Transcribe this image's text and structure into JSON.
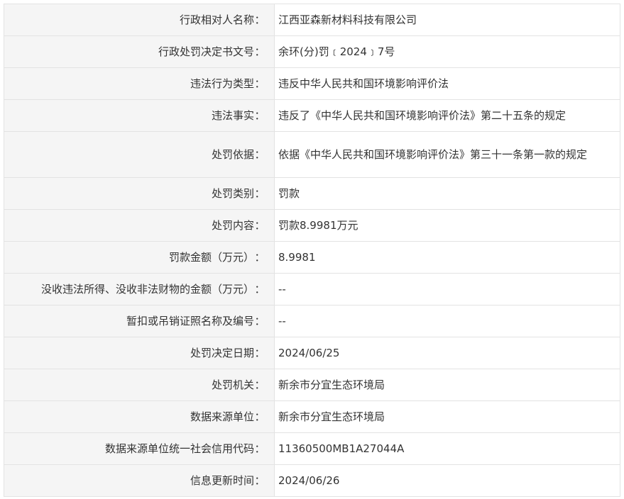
{
  "separator": "：",
  "rows": [
    {
      "label": "行政相对人名称",
      "value": "江西亚森新材料科技有限公司"
    },
    {
      "label": "行政处罚决定书文号",
      "value": "余环(分)罚﹝2024﹞7号"
    },
    {
      "label": "违法行为类型",
      "value": "违反中华人民共和国环境影响评价法"
    },
    {
      "label": "违法事实",
      "value": "违反了《中华人民共和国环境影响评价法》第二十五条的规定"
    },
    {
      "label": "处罚依据",
      "value": "依据《中华人民共和国环境影响评价法》第三十一条第一款的规定"
    },
    {
      "label": "处罚类别",
      "value": "罚款"
    },
    {
      "label": "处罚内容",
      "value": "罚款8.9981万元"
    },
    {
      "label": "罚款金额（万元）",
      "value": "8.9981"
    },
    {
      "label": "没收违法所得、没收非法财物的金额（万元）",
      "value": "--"
    },
    {
      "label": "暂扣或吊销证照名称及编号",
      "value": "--"
    },
    {
      "label": "处罚决定日期",
      "value": "2024/06/25"
    },
    {
      "label": "处罚机关",
      "value": "新余市分宜生态环境局"
    },
    {
      "label": "数据来源单位",
      "value": "新余市分宜生态环境局"
    },
    {
      "label": "数据来源单位统一社会信用代码",
      "value": "11360500MB1A27044A"
    },
    {
      "label": "信息更新时间",
      "value": "2024/06/26"
    }
  ]
}
